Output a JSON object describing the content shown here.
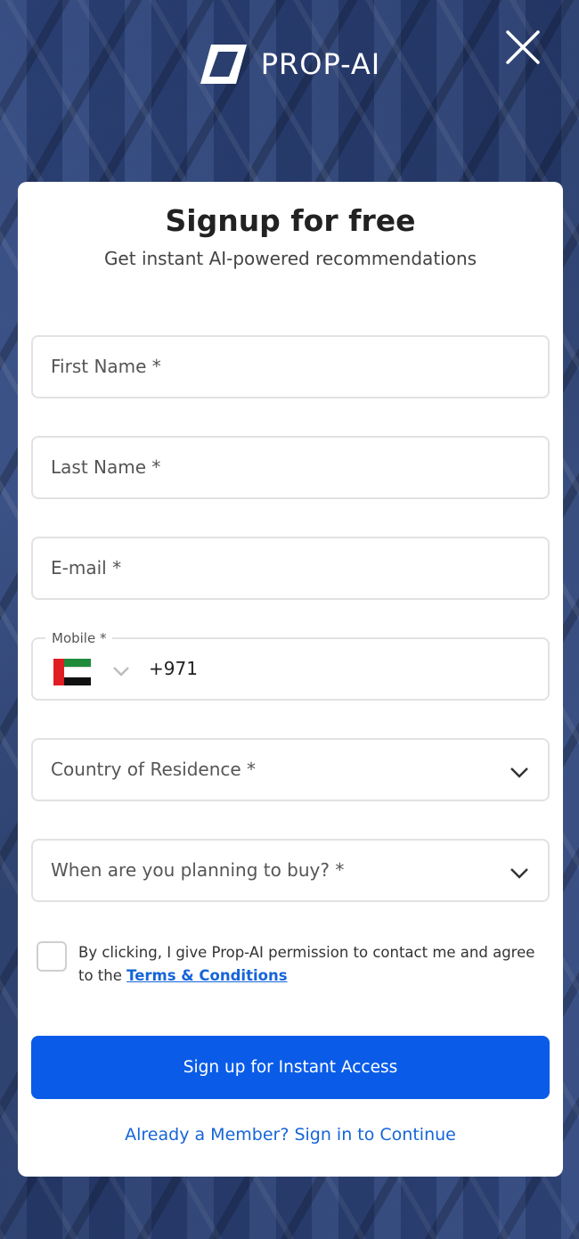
{
  "brand": {
    "name": "PROP-AI"
  },
  "header": {
    "close_icon": "close-icon"
  },
  "form": {
    "title": "Signup for free",
    "subtitle": "Get instant AI-powered recommendations",
    "first_name": {
      "placeholder": "First Name *",
      "value": ""
    },
    "last_name": {
      "placeholder": "Last Name *",
      "value": ""
    },
    "email": {
      "placeholder": "E-mail *",
      "value": ""
    },
    "mobile": {
      "label": "Mobile *",
      "country_flag": "uae-flag-icon",
      "dial_code": "+971",
      "value": ""
    },
    "country": {
      "placeholder": "Country of Residence *",
      "selected": ""
    },
    "timeline": {
      "placeholder": "When are you planning to buy? *",
      "selected": ""
    },
    "consent": {
      "text": "By clicking, I give Prop-AI permission to contact me and agree to the ",
      "link": "Terms & Conditions",
      "checked": false
    },
    "submit_label": "Sign up for Instant Access",
    "signin_label": "Already a Member? Sign in to Continue"
  },
  "colors": {
    "primary": "#0a5ce8",
    "link": "#1565d8",
    "text": "#222222"
  }
}
